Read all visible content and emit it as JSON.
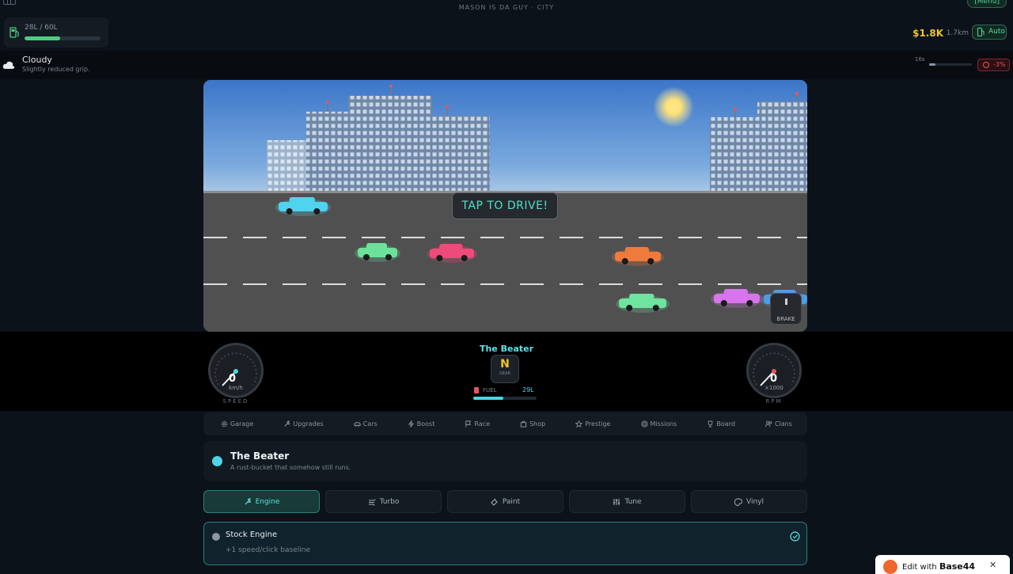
{
  "header": {
    "title": "MASON IS DA GUY · CITY",
    "menu_label": "[Menu]",
    "fuel": {
      "text": "28L / 60L",
      "level": 0.47
    },
    "money": "$1.8K",
    "distance": "1.7km",
    "auto_label": "Auto"
  },
  "weather": {
    "title": "Cloudy",
    "description": "Slightly reduced grip.",
    "timer": "16s",
    "timer_level": 0.15,
    "penalty": "-3%"
  },
  "scene": {
    "prompt": "TAP TO DRIVE!",
    "brake_label": "BRAKE",
    "car_colors": [
      "#4fd3ef",
      "#6be19a",
      "#ee4b7a",
      "#ee7a3d",
      "#6fe4a0",
      "#d874ec",
      "#4d9ce6"
    ]
  },
  "dashboard": {
    "speed": {
      "value": "0",
      "unit": "km/h",
      "label": "SPEED"
    },
    "rpm": {
      "value": "0",
      "unit": "×1000",
      "label": "RPM"
    },
    "car_name": "The Beater",
    "gear": "N",
    "gear_label": "GEAR",
    "fuel_label": "FUEL",
    "fuel_value": "29L",
    "fuel_level": 0.47
  },
  "nav": {
    "items": [
      {
        "label": "Garage",
        "icon": "gear-icon"
      },
      {
        "label": "Upgrades",
        "icon": "wrench-icon"
      },
      {
        "label": "Cars",
        "icon": "car-icon"
      },
      {
        "label": "Boost",
        "icon": "bolt-icon"
      },
      {
        "label": "Race",
        "icon": "flag-icon"
      },
      {
        "label": "Shop",
        "icon": "shop-icon"
      },
      {
        "label": "Prestige",
        "icon": "star-icon"
      },
      {
        "label": "Missions",
        "icon": "target-icon"
      },
      {
        "label": "Board",
        "icon": "trophy-icon"
      },
      {
        "label": "Clans",
        "icon": "users-icon"
      }
    ]
  },
  "car": {
    "name": "The Beater",
    "description": "A rust-bucket that somehow still runs.",
    "color": "#4fd3e6"
  },
  "upgrade_tabs": {
    "engine": "Engine",
    "turbo": "Turbo",
    "paint": "Paint",
    "tune": "Tune",
    "vinyl": "Vinyl"
  },
  "upgrade": {
    "title": "Stock Engine",
    "description": "+1 speed/click baseline"
  },
  "badge": {
    "prefix": "Edit with",
    "brand": "Base44",
    "close": "✕"
  }
}
